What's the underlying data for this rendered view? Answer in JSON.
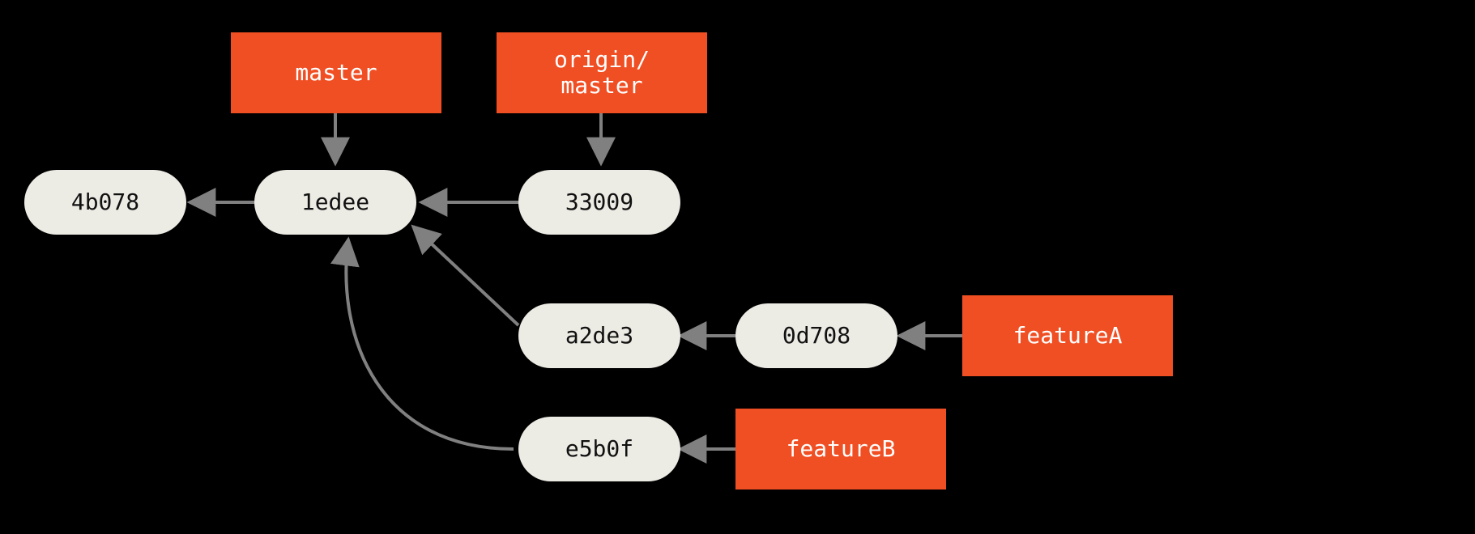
{
  "colors": {
    "background": "#000000",
    "commit_fill": "#ecebe4",
    "commit_text": "#111111",
    "branch_fill": "#f04e23",
    "branch_text": "#ffffff",
    "edge": "#808080"
  },
  "commits": {
    "c4b078": "4b078",
    "c1edee": "1edee",
    "c33009": "33009",
    "ca2de3": "a2de3",
    "c0d708": "0d708",
    "ce5b0f": "e5b0f"
  },
  "branches": {
    "master": "master",
    "origin_master": "origin/\nmaster",
    "featureA": "featureA",
    "featureB": "featureB"
  },
  "edges": [
    {
      "from": "master",
      "to": "c1edee",
      "kind": "branch-to-commit"
    },
    {
      "from": "origin_master",
      "to": "c33009",
      "kind": "branch-to-commit"
    },
    {
      "from": "featureA",
      "to": "c0d708",
      "kind": "branch-to-commit"
    },
    {
      "from": "featureB",
      "to": "ce5b0f",
      "kind": "branch-to-commit"
    },
    {
      "from": "c1edee",
      "to": "c4b078",
      "kind": "parent"
    },
    {
      "from": "c33009",
      "to": "c1edee",
      "kind": "parent"
    },
    {
      "from": "ca2de3",
      "to": "c1edee",
      "kind": "parent"
    },
    {
      "from": "ce5b0f",
      "to": "c1edee",
      "kind": "parent"
    },
    {
      "from": "c0d708",
      "to": "ca2de3",
      "kind": "parent"
    }
  ]
}
